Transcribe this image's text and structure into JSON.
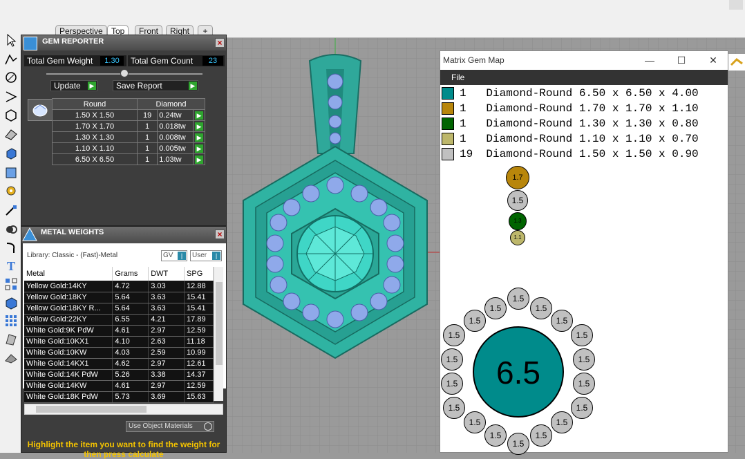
{
  "viewport_tabs": [
    "Perspective",
    "Top",
    "Front",
    "Right",
    "+"
  ],
  "gem_reporter": {
    "title": "GEM REPORTER",
    "total_gem_weight_label": "Total Gem Weight",
    "total_gem_weight": "1.30",
    "total_gem_count_label": "Total Gem Count",
    "total_gem_count": "23",
    "update_label": "Update",
    "save_report_label": "Save Report",
    "col_round": "Round",
    "col_diamond": "Diamond",
    "rows": [
      {
        "size": "1.50 X 1.50",
        "count": "19",
        "weight": "0.24tw"
      },
      {
        "size": "1.70 X 1.70",
        "count": "1",
        "weight": "0.018tw"
      },
      {
        "size": "1.30 X 1.30",
        "count": "1",
        "weight": "0.008tw"
      },
      {
        "size": "1.10 X 1.10",
        "count": "1",
        "weight": "0.005tw"
      },
      {
        "size": "6.50 X 6.50",
        "count": "1",
        "weight": "1.03tw"
      }
    ]
  },
  "metal_weights": {
    "title": "METAL WEIGHTS",
    "library": "Library: Classic - (Fast)-Metal",
    "gv": "GV",
    "user": "User",
    "headers": [
      "Metal",
      "Grams",
      "DWT",
      "SPG"
    ],
    "rows": [
      [
        "Yellow Gold:14KY",
        "4.72",
        "3.03",
        "12.88"
      ],
      [
        "Yellow Gold:18KY",
        "5.64",
        "3.63",
        "15.41"
      ],
      [
        "Yellow Gold:18KY R...",
        "5.64",
        "3.63",
        "15.41"
      ],
      [
        "Yellow Gold:22KY",
        "6.55",
        "4.21",
        "17.89"
      ],
      [
        "White Gold:9K PdW",
        "4.61",
        "2.97",
        "12.59"
      ],
      [
        "White Gold:10KX1",
        "4.10",
        "2.63",
        "11.18"
      ],
      [
        "White Gold:10KW",
        "4.03",
        "2.59",
        "10.99"
      ],
      [
        "White Gold:14KX1",
        "4.62",
        "2.97",
        "12.61"
      ],
      [
        "White Gold:14K PdW",
        "5.26",
        "3.38",
        "14.37"
      ],
      [
        "White Gold:14KW",
        "4.61",
        "2.97",
        "12.59"
      ],
      [
        "White Gold:18K PdW",
        "5.73",
        "3.69",
        "15.63"
      ]
    ],
    "use_object_materials": "Use Object Materials",
    "hint": "Highlight the item you want to find the weight for then press calculate"
  },
  "gem_map": {
    "title": "Matrix Gem Map",
    "menu_file": "File",
    "rows": [
      {
        "color": "#008b8b",
        "text": "1   Diamond-Round 6.50 x 6.50 x 4.00"
      },
      {
        "color": "#b8860b",
        "text": "1   Diamond-Round 1.70 x 1.70 x 1.10"
      },
      {
        "color": "#006400",
        "text": "1   Diamond-Round 1.30 x 1.30 x 0.80"
      },
      {
        "color": "#bdb76b",
        "text": "1   Diamond-Round 1.10 x 1.10 x 0.70"
      },
      {
        "color": "#c0c0c0",
        "text": "19  Diamond-Round 1.50 x 1.50 x 0.90"
      }
    ],
    "small_stones": [
      "1.7",
      "1.5",
      "1.3",
      "1.1"
    ],
    "center": "6.5",
    "ring_label": "1.5"
  }
}
